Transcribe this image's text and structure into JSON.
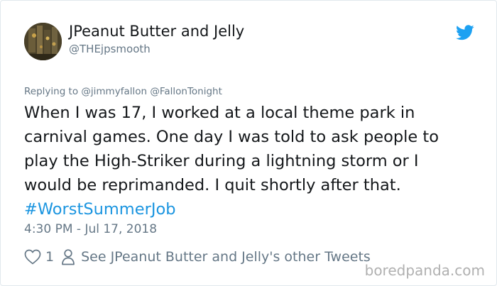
{
  "author": {
    "display_name": "JPeanut Butter and Jelly",
    "handle": "@THEjpsmooth"
  },
  "tweet": {
    "replying_to": "Replying to @jimmyfallon @FallonTonight",
    "lines": [
      "When I was 17, I worked at a local theme park in",
      "carnival games. One day I was told to ask people to",
      "play the High-Striker during a lightning storm or I",
      "would be reprimanded. I quit shortly after that."
    ],
    "hashtag": "#WorstSummerJob",
    "timestamp": "4:30 PM - Jul 17, 2018"
  },
  "actions": {
    "like_count": "1",
    "see_more_label": "See JPeanut Butter and Jelly's other Tweets"
  },
  "watermark": "boredpanda.com",
  "icons": {
    "brand": "twitter-bird-icon",
    "like": "heart-icon",
    "profile": "person-icon"
  },
  "colors": {
    "twitter_blue": "#1da1f2",
    "hashtag": "#1b95e0",
    "muted": "#657786",
    "text": "#14171a"
  }
}
